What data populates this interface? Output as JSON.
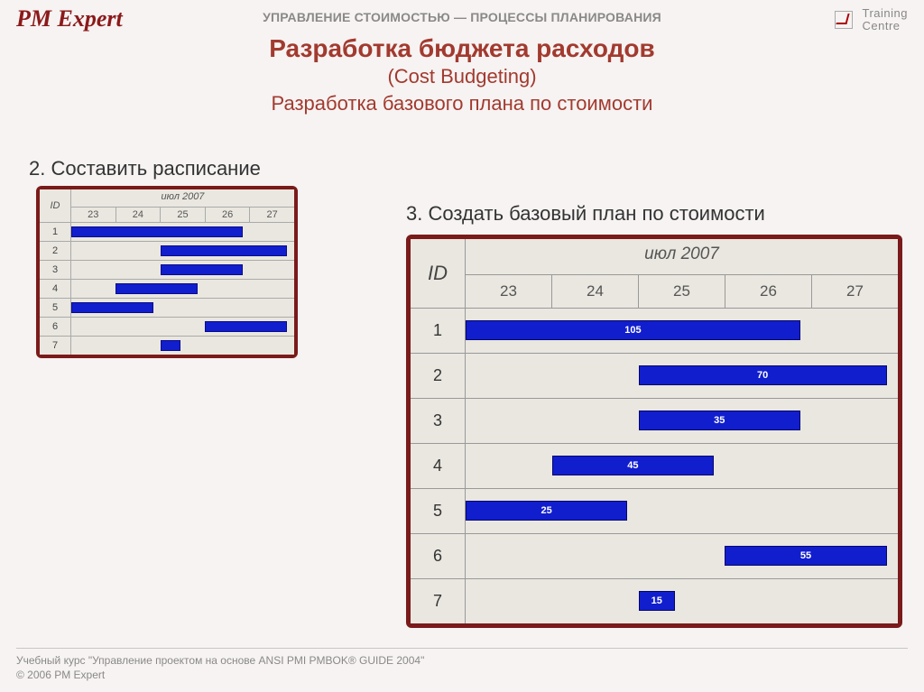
{
  "brand": "PM Expert",
  "topbar": "УПРАВЛЕНИЕ СТОИМОСТЬЮ — ПРОЦЕССЫ ПЛАНИРОВАНИЯ",
  "logo_line1": "Training",
  "logo_line2": "Centre",
  "title_main": "Разработка бюджета расходов",
  "title_sub1": "(Cost Budgeting)",
  "title_sub2": "Разработка базового плана по стоимости",
  "step2": "2. Составить расписание",
  "step3": "3. Создать базовый план по стоимости",
  "id_label": "ID",
  "month_label": "июл 2007",
  "days": [
    "23",
    "24",
    "25",
    "26",
    "27"
  ],
  "footer_line1": "Учебный курс \"Управление проектом на основе ANSI PMI PMBOK® GUIDE 2004\"",
  "footer_line2": "© 2006 PM Expert",
  "chart_data": [
    {
      "type": "bar",
      "title": "Расписание (Gantt, small)",
      "categories": [
        "23",
        "24",
        "25",
        "26",
        "27"
      ],
      "series": [
        {
          "name": "1",
          "start": 23,
          "end": 26
        },
        {
          "name": "2",
          "start": 25,
          "end": 27
        },
        {
          "name": "3",
          "start": 25,
          "end": 26
        },
        {
          "name": "4",
          "start": 24,
          "end": 25
        },
        {
          "name": "5",
          "start": 23,
          "end": 24
        },
        {
          "name": "6",
          "start": 26,
          "end": 27
        },
        {
          "name": "7",
          "start": 25,
          "end": 25.4
        }
      ]
    },
    {
      "type": "bar",
      "title": "Базовый план по стоимости (Gantt with cost labels)",
      "categories": [
        "23",
        "24",
        "25",
        "26",
        "27"
      ],
      "series": [
        {
          "name": "1",
          "start": 23,
          "end": 26,
          "value": 105
        },
        {
          "name": "2",
          "start": 25,
          "end": 27,
          "value": 70
        },
        {
          "name": "3",
          "start": 25,
          "end": 26,
          "value": 35
        },
        {
          "name": "4",
          "start": 24,
          "end": 25,
          "value": 45
        },
        {
          "name": "5",
          "start": 23,
          "end": 24,
          "value": 25
        },
        {
          "name": "6",
          "start": 26,
          "end": 27,
          "value": 55
        },
        {
          "name": "7",
          "start": 25,
          "end": 25.4,
          "value": 15
        }
      ]
    }
  ]
}
